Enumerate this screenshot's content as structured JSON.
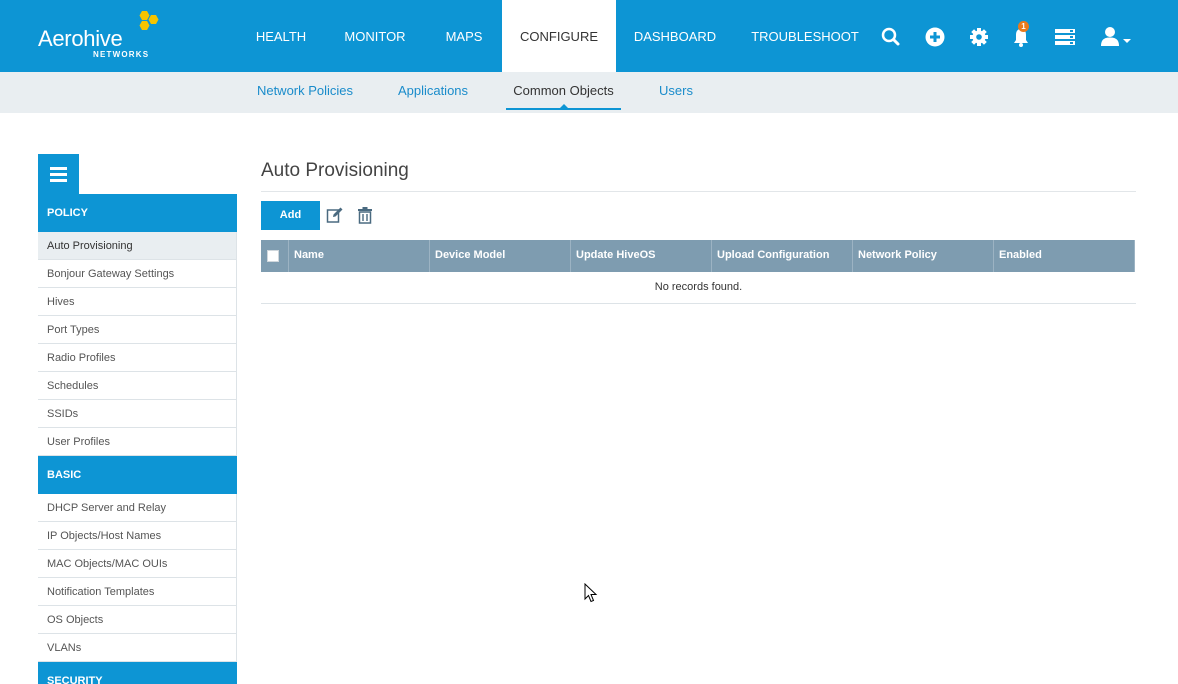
{
  "brand": {
    "name": "Aerohive",
    "sub": "NETWORKS",
    "accent": "#0d95d4",
    "logo_hex_color": "#f5c400"
  },
  "nav": {
    "items": [
      {
        "label": "HEALTH"
      },
      {
        "label": "MONITOR"
      },
      {
        "label": "MAPS"
      },
      {
        "label": "CONFIGURE",
        "active": true
      },
      {
        "label": "DASHBOARD"
      },
      {
        "label": "TROUBLESHOOT"
      }
    ],
    "icons": [
      "search-icon",
      "add-circle-icon",
      "gear-icon",
      "bell-icon",
      "server-stack-icon",
      "user-icon"
    ],
    "notification_count": "1"
  },
  "subnav": {
    "items": [
      {
        "label": "Network Policies"
      },
      {
        "label": "Applications"
      },
      {
        "label": "Common Objects",
        "active": true
      },
      {
        "label": "Users"
      }
    ]
  },
  "sidebar": {
    "sections": [
      {
        "title": "POLICY",
        "items": [
          "Auto Provisioning",
          "Bonjour Gateway Settings",
          "Hives",
          "Port Types",
          "Radio Profiles",
          "Schedules",
          "SSIDs",
          "User Profiles"
        ]
      },
      {
        "title": "BASIC",
        "items": [
          "DHCP Server and Relay",
          "IP Objects/Host Names",
          "MAC Objects/MAC OUIs",
          "Notification Templates",
          "OS Objects",
          "VLANs"
        ]
      },
      {
        "title": "SECURITY",
        "items": []
      }
    ],
    "active_item": "Auto Provisioning"
  },
  "main": {
    "title": "Auto Provisioning",
    "add_label": "Add",
    "columns": [
      "Name",
      "Device Model",
      "Update HiveOS",
      "Upload Configuration",
      "Network Policy",
      "Enabled"
    ],
    "empty_message": "No records found."
  }
}
